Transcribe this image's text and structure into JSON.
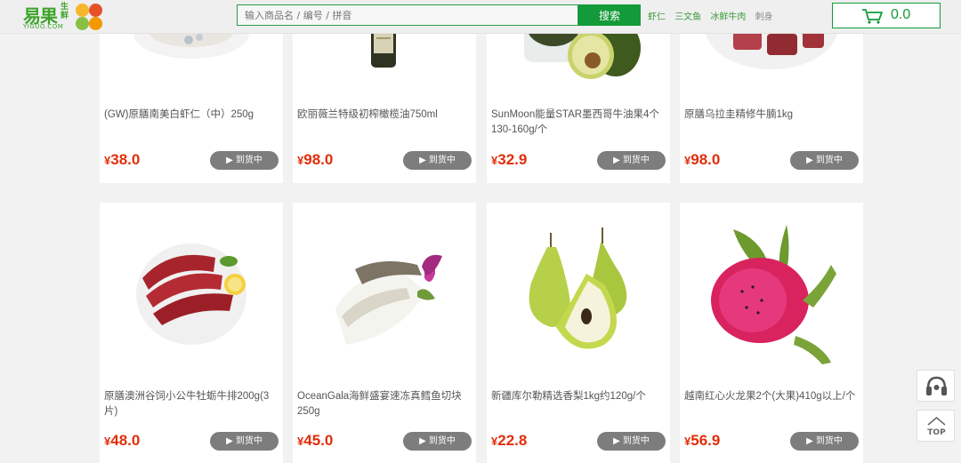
{
  "logo": {
    "cn": "易果",
    "sub": "生鲜",
    "en": "YIGUO.COM",
    "dot_colors": [
      "#f8b62d",
      "#e5522a",
      "#89c043",
      "#f39800"
    ]
  },
  "search": {
    "placeholder": "输入商品名 / 编号 / 拼音",
    "button_label": "搜索"
  },
  "hot_words": [
    "虾仁",
    "三文鱼",
    "冰鲜牛肉",
    "刺身"
  ],
  "cart": {
    "total": "0.0",
    "icon": "cart-icon"
  },
  "products": [
    {
      "name": "(GW)原膳南美白虾仁（中）250g",
      "price": "38.0",
      "currency": "¥",
      "button_label": "▶ 到货中",
      "image": "shrimp-plate-image"
    },
    {
      "name": "欧丽薇兰特级初榨橄榄油750ml",
      "price": "98.0",
      "currency": "¥",
      "button_label": "▶ 到货中",
      "image": "olive-oil-bottle-image"
    },
    {
      "name": "SunMoon能量STAR墨西哥牛油果4个130-160g/个",
      "price": "32.9",
      "currency": "¥",
      "button_label": "▶ 到货中",
      "image": "avocado-image"
    },
    {
      "name": "原膳乌拉圭精修牛腩1kg",
      "price": "98.0",
      "currency": "¥",
      "button_label": "▶ 到货中",
      "image": "beef-brisket-image"
    },
    {
      "name": "原膳澳洲谷饲小公牛牡蛎牛排200g(3片)",
      "price": "48.0",
      "currency": "¥",
      "button_label": "▶ 到货中",
      "image": "beef-steak-plate-image"
    },
    {
      "name": "OceanGala海鲜盛宴速冻真鳕鱼切块250g",
      "price": "45.0",
      "currency": "¥",
      "button_label": "▶ 到货中",
      "image": "cod-fillet-image"
    },
    {
      "name": "新疆库尔勒精选香梨1kg约120g/个",
      "price": "22.8",
      "currency": "¥",
      "button_label": "▶ 到货中",
      "image": "pear-image"
    },
    {
      "name": "越南红心火龙果2个(大果)410g以上/个",
      "price": "56.9",
      "currency": "¥",
      "button_label": "▶ 到货中",
      "image": "dragon-fruit-image"
    }
  ],
  "floating": {
    "service_icon": "headset-icon",
    "top_label": "TOP"
  },
  "colors": {
    "brand_green": "#139a39",
    "price_red": "#e12e0a",
    "button_gray": "#7d7d7d"
  }
}
